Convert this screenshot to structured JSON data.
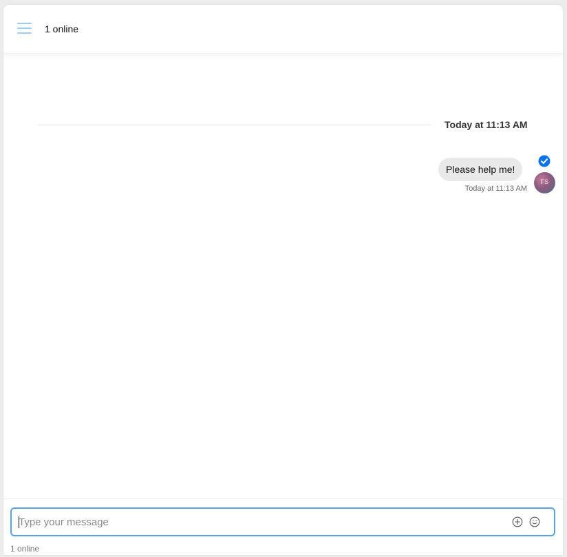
{
  "header": {
    "menu_icon": "hamburger-menu-icon",
    "title": "1 online"
  },
  "conversation": {
    "date_divider": "Today at 11:13 AM",
    "messages": [
      {
        "text": "Please help me!",
        "time": "Today at 11:13 AM",
        "avatar_initials": "FS",
        "read_icon": "check-circle-icon"
      }
    ]
  },
  "composer": {
    "placeholder": "Type your message",
    "value": "",
    "attach_icon": "plus-circle-icon",
    "emoji_icon": "smiley-icon"
  },
  "footer": {
    "status": "1 online"
  },
  "colors": {
    "accent": "#0a74e8",
    "menu_icon": "#9fcbf5",
    "input_border": "#5ba1e8",
    "bubble": "#e9e9e9"
  }
}
